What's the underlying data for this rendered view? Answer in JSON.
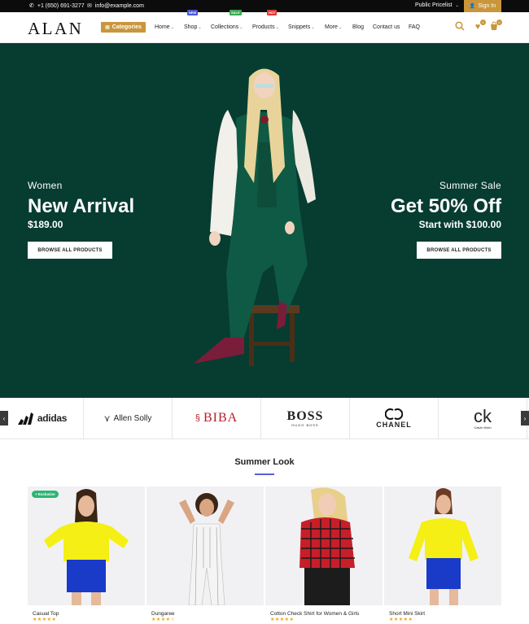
{
  "topbar": {
    "phone": "+1 (650) 691-3277",
    "email": "info@example.com",
    "pricelist": "Public Pricelist",
    "signin": "Sign In"
  },
  "header": {
    "logo": "ALAN",
    "categories_label": "Categories",
    "nav": [
      "Home",
      "Shop",
      "Collections",
      "Products",
      "Snippets",
      "More",
      "Blog",
      "Contact us",
      "FAQ"
    ],
    "badges": {
      "shop": "NEW",
      "collections": "SALE",
      "products": "HOT"
    },
    "wishlist_count": "0",
    "cart_count": "0"
  },
  "hero": {
    "left": {
      "kicker": "Women",
      "headline": "New Arrival",
      "price": "$189.00",
      "cta": "BROWSE ALL PRODUCTS"
    },
    "right": {
      "kicker": "Summer Sale",
      "headline": "Get 50% Off",
      "price": "Start with $100.00",
      "cta": "BROWSE ALL PRODUCTS"
    },
    "bg_color": "#073c31"
  },
  "brands": [
    "adidas",
    "Allen Solly",
    "BIBA",
    "BOSS",
    "CHANEL",
    "ck"
  ],
  "brand_sublabels": {
    "boss": "HUGO BOSS",
    "ck": "Calvin Klein"
  },
  "section": {
    "title": "Summer Look"
  },
  "products": [
    {
      "name": "Casual Top",
      "stars": "★★★★★",
      "badge": "+ Exclusive"
    },
    {
      "name": "Dungaree",
      "stars": "★★★★☆"
    },
    {
      "name": "Cotton Check Shirt for Women & Girls",
      "stars": "★★★★★"
    },
    {
      "name": "Short Mini Skirt",
      "stars": "★★★★★"
    }
  ],
  "colors": {
    "accent": "#c9963c",
    "hero": "#073c31",
    "underline": "#5a5fd6",
    "stars": "#f0a21b"
  }
}
